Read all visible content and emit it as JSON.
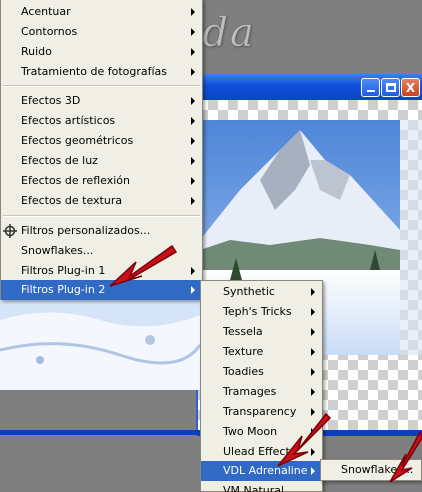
{
  "watermark": {
    "text": "Amanda"
  },
  "window_buttons": {
    "close_label": "X"
  },
  "main_menu": {
    "items": [
      {
        "label": "Acentuar",
        "arrow": true
      },
      {
        "label": "Contornos",
        "arrow": true
      },
      {
        "label": "Ruido",
        "arrow": true
      },
      {
        "label": "Tratamiento de fotografías",
        "arrow": true
      },
      {
        "label": "Efectos 3D",
        "arrow": true
      },
      {
        "label": "Efectos artísticos",
        "arrow": true
      },
      {
        "label": "Efectos geométricos",
        "arrow": true
      },
      {
        "label": "Efectos de luz",
        "arrow": true
      },
      {
        "label": "Efectos de reflexión",
        "arrow": true
      },
      {
        "label": "Efectos de textura",
        "arrow": true
      },
      {
        "label": "Filtros personalizados...",
        "arrow": false,
        "icon": "filter-icon"
      },
      {
        "label": "Snowflakes...",
        "arrow": false
      },
      {
        "label": "Filtros Plug-in 1",
        "arrow": true
      },
      {
        "label": "Filtros Plug-in 2",
        "arrow": true,
        "selected": true
      }
    ]
  },
  "submenu_plugins": {
    "items": [
      {
        "label": "Synthetic"
      },
      {
        "label": "Teph's Tricks"
      },
      {
        "label": "Tessela"
      },
      {
        "label": "Texture"
      },
      {
        "label": "Toadies"
      },
      {
        "label": "Tramages"
      },
      {
        "label": "Transparency"
      },
      {
        "label": "Two Moon"
      },
      {
        "label": "Ulead Effects"
      },
      {
        "label": "VDL Adrenaline",
        "selected": true
      },
      {
        "label": "VM Natural"
      }
    ]
  },
  "submenu_vdl": {
    "items": [
      {
        "label": "Snowflakes..."
      }
    ]
  },
  "colors": {
    "menu_bg": "#f0efe5",
    "selection": "#316ac5",
    "titlebar": "#0f50d8",
    "annotation_arrow": "#c8101a"
  }
}
